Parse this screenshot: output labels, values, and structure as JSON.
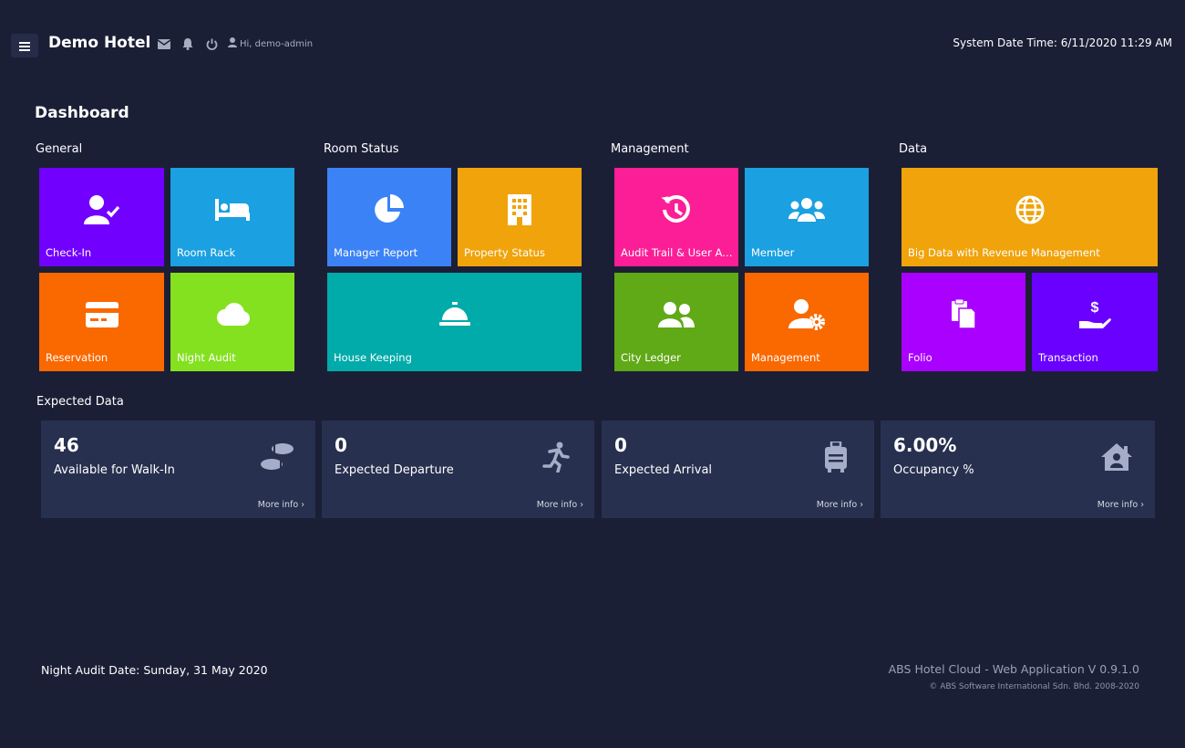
{
  "header": {
    "title": "Demo Hotel",
    "greeting": "Hi, demo-admin",
    "system_datetime": "System Date Time: 6/11/2020 11:29 AM"
  },
  "page": {
    "title": "Dashboard"
  },
  "sections": {
    "general": "General",
    "room_status": "Room Status",
    "management": "Management",
    "data": "Data"
  },
  "tiles": [
    {
      "label": "Check-In",
      "color": "#7200ff",
      "icon": "user-check-icon"
    },
    {
      "label": "Room Rack",
      "color": "#1ba0e1",
      "icon": "bed-icon"
    },
    {
      "label": "Reservation",
      "color": "#fa6800",
      "icon": "credit-card-icon"
    },
    {
      "label": "Night Audit",
      "color": "#84e120",
      "icon": "cloud-icon"
    },
    {
      "label": "Manager Report",
      "color": "#3b82f6",
      "icon": "pie-chart-icon"
    },
    {
      "label": "Property Status",
      "color": "#f0a30a",
      "icon": "building-icon"
    },
    {
      "label": "House Keeping",
      "color": "#00aba9",
      "icon": "concierge-bell-icon"
    },
    {
      "label": "Audit Trail & User Activity",
      "color": "#fc1e96",
      "icon": "history-icon"
    },
    {
      "label": "Member",
      "color": "#1ba0e1",
      "icon": "users-icon"
    },
    {
      "label": "City Ledger",
      "color": "#60a917",
      "icon": "user-friends-icon"
    },
    {
      "label": "Management",
      "color": "#fa6800",
      "icon": "user-cog-icon"
    },
    {
      "label": "Big Data with Revenue Management",
      "color": "#f0a30a",
      "icon": "globe-icon"
    },
    {
      "label": "Folio",
      "color": "#aa00ff",
      "icon": "copy-icon"
    },
    {
      "label": "Transaction",
      "color": "#6a00ff",
      "icon": "hand-dollar-icon"
    }
  ],
  "expected": {
    "title": "Expected Data",
    "cards": [
      {
        "value": "46",
        "label": "Available for Walk-In",
        "more": "More info ›",
        "icon": "footprints-icon"
      },
      {
        "value": "0",
        "label": "Expected Departure",
        "more": "More info ›",
        "icon": "running-icon"
      },
      {
        "value": "0",
        "label": "Expected Arrival",
        "more": "More info ›",
        "icon": "suitcase-icon"
      },
      {
        "value": "6.00%",
        "label": "Occupancy %",
        "more": "More info ›",
        "icon": "house-user-icon"
      }
    ]
  },
  "footer": {
    "night_audit": "Night Audit Date: Sunday, 31 May 2020",
    "version": "ABS Hotel Cloud - Web Application V 0.9.1.0",
    "copyright": "© ABS Software International Sdn. Bhd. 2008-2020"
  }
}
